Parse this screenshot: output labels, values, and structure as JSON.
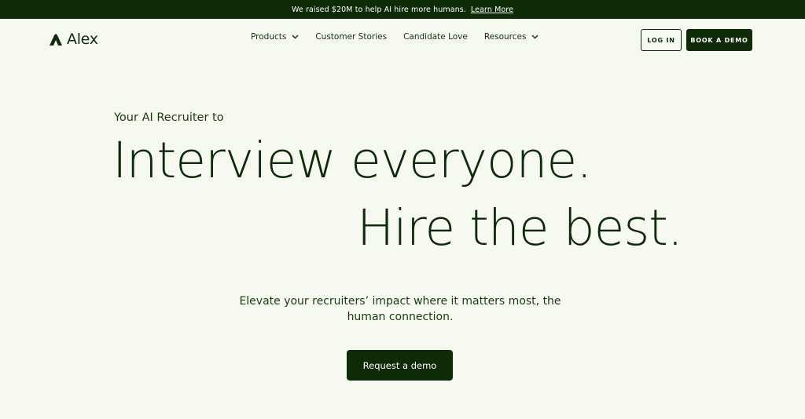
{
  "announcement": {
    "message": "We raised $20M to help AI hire more humans.",
    "link": "Learn More"
  },
  "nav": {
    "logo": "Alex",
    "items": [
      {
        "label": "Products",
        "has_dropdown": true
      },
      {
        "label": "Customer Stories",
        "has_dropdown": false
      },
      {
        "label": "Candidate Love",
        "has_dropdown": false
      },
      {
        "label": "Resources",
        "has_dropdown": true
      }
    ],
    "login": "LOG IN",
    "book_demo": "BOOK A DEMO"
  },
  "hero": {
    "eyebrow": "Your AI Recruiter to",
    "headline_line1": "Interview everyone.",
    "headline_line2": "Hire the best.",
    "subtext": "Elevate your recruiters’ impact where it matters most, the human connection.",
    "cta": "Request a demo"
  },
  "colors": {
    "background": "#f5f9f0",
    "brand_dark_green": "#0e2a06",
    "text": "#0f2a0a"
  },
  "icons": {
    "logo": "alex-logo-icon",
    "dropdown": "chevron-down-icon"
  }
}
